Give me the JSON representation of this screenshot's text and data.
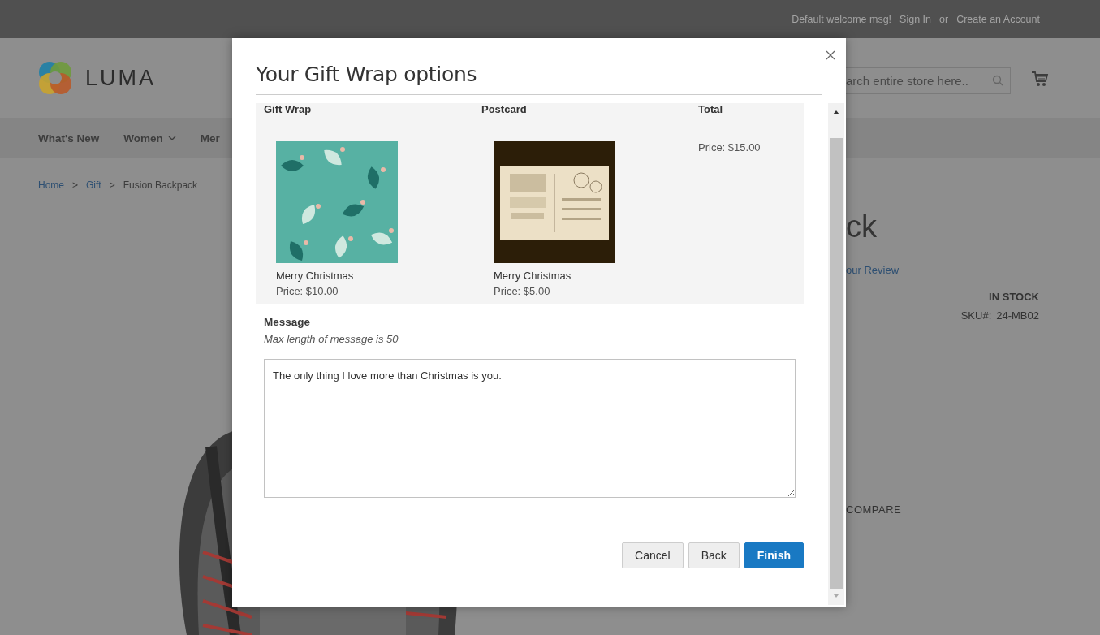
{
  "top_bar": {
    "welcome": "Default welcome msg!",
    "sign_in": "Sign In",
    "separator": "or",
    "create_account": "Create an Account"
  },
  "header": {
    "logo": "LUMA",
    "search": {
      "placeholder": "arch entire store here.."
    }
  },
  "nav": {
    "items": [
      {
        "label": "What's New",
        "has_dropdown": false
      },
      {
        "label": "Women",
        "has_dropdown": true
      },
      {
        "label": "Mer",
        "has_dropdown": false
      }
    ]
  },
  "breadcrumbs": [
    {
      "kind": "link",
      "label": "Home"
    },
    {
      "kind": "separator",
      "label": ">"
    },
    {
      "kind": "link",
      "label": "Gift"
    },
    {
      "kind": "separator",
      "label": ">"
    },
    {
      "kind": "current",
      "label": "Fusion Backpack"
    }
  ],
  "product": {
    "title": "ck",
    "review_link": "our Review",
    "stock": "IN STOCK",
    "sku_label": "SKU#:",
    "sku": "24-MB02",
    "compare": "COMPARE"
  },
  "modal": {
    "title": "Your Gift Wrap options",
    "columns": [
      "Gift Wrap",
      "Postcard",
      "Total"
    ],
    "items": [
      {
        "kind": "wrap",
        "name": "Merry Christmas",
        "price": "Price: $10.00"
      },
      {
        "kind": "postcard",
        "name": "Merry Christmas",
        "price": "Price: $5.00"
      }
    ],
    "total": "Price: $15.00",
    "message": {
      "label": "Message",
      "hint": "Max length of message is 50",
      "value": "The only thing I love more than Christmas is you."
    },
    "buttons": [
      {
        "label": "Cancel",
        "kind": "secondary"
      },
      {
        "label": "Back",
        "kind": "secondary"
      },
      {
        "label": "Finish",
        "kind": "primary"
      }
    ]
  }
}
